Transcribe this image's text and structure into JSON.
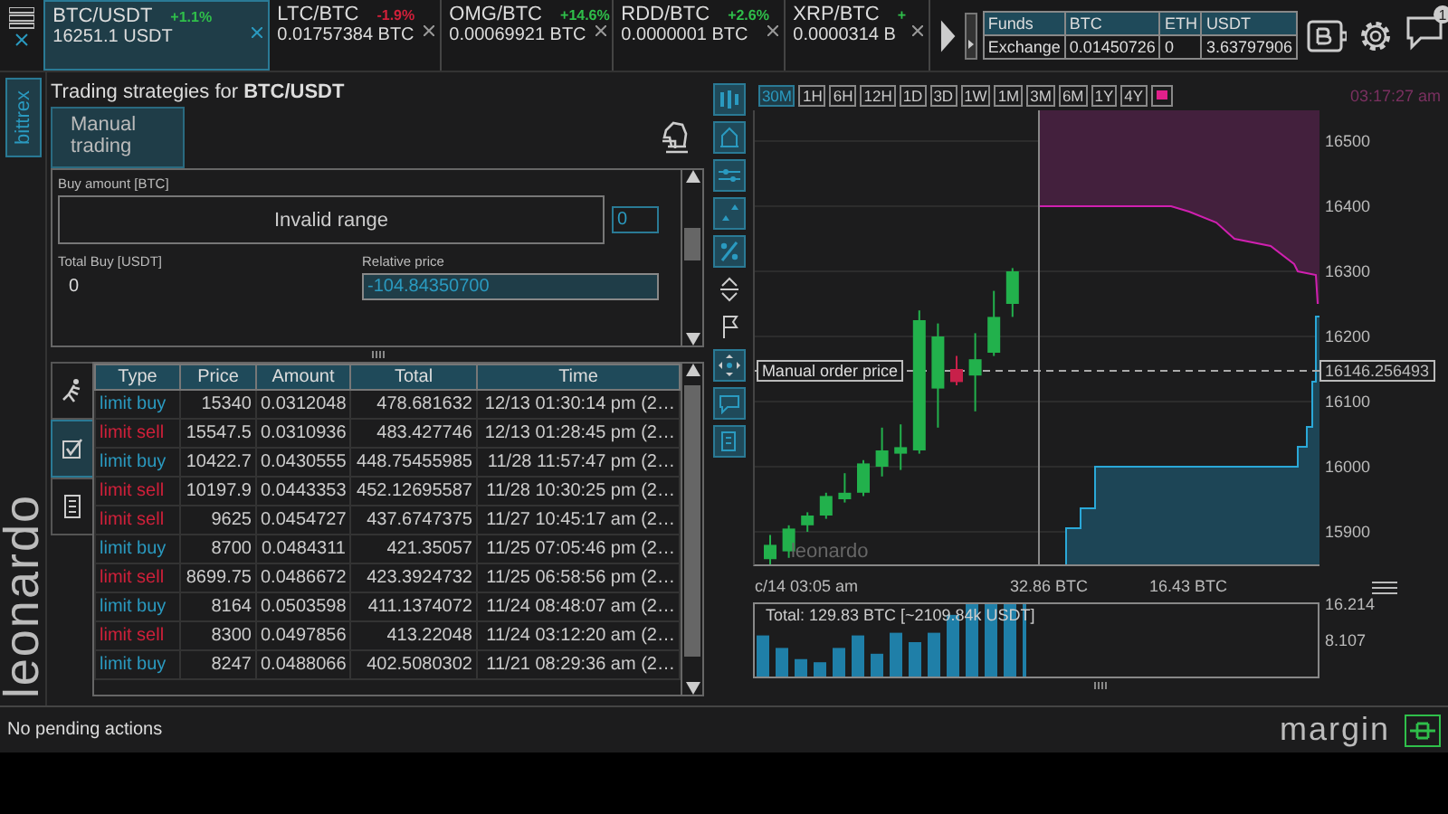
{
  "tickers": [
    {
      "pair": "BTC/USDT",
      "change": "+1.1%",
      "color": "#2fbf4a",
      "price": "16251.1 USDT",
      "selected": true
    },
    {
      "pair": "LTC/BTC",
      "change": "-1.9%",
      "color": "#d0203a",
      "price": "0.01757384 BTC",
      "selected": false
    },
    {
      "pair": "OMG/BTC",
      "change": "+14.6%",
      "color": "#2fbf4a",
      "price": "0.00069921 BTC",
      "selected": false
    },
    {
      "pair": "RDD/BTC",
      "change": "+2.6%",
      "color": "#2fbf4a",
      "price": "0.0000001 BTC",
      "selected": false
    },
    {
      "pair": "XRP/BTC",
      "change": "+",
      "color": "#2fbf4a",
      "price": "0.0000314 B",
      "selected": false
    }
  ],
  "funds": {
    "columns": [
      "Funds",
      "BTC",
      "ETH",
      "USDT"
    ],
    "row": [
      "Exchange",
      "0.01450726",
      "0",
      "3.63797906"
    ]
  },
  "notifications": {
    "badge": "1"
  },
  "exchange_tab": {
    "label": "bittrex",
    "selected": true
  },
  "logo": "leonardo",
  "title": "Trading strategies for **BTC/USDT**",
  "tabs": [
    {
      "label": "Manual trading",
      "selected": true
    }
  ],
  "form": {
    "buy_amount_label": "Buy amount [BTC]",
    "range_message": "Invalid range",
    "amount_value": "0",
    "total_label": "Total Buy [USDT]",
    "total_value": "0",
    "relative_price_label": "Relative price",
    "relative_price_value": "-104.84350700"
  },
  "side_tabs": [
    {
      "kind": "runner",
      "selected": false
    },
    {
      "kind": "checklist",
      "selected": true
    },
    {
      "kind": "scroll",
      "selected": false
    }
  ],
  "orders": {
    "columns": [
      "Type",
      "Price",
      "Amount",
      "Total",
      "Time"
    ],
    "rows": [
      {
        "kind": "buy",
        "type": "limit buy",
        "price": "15340",
        "amount": "0.0312048",
        "total": "478.681632",
        "time": "12/13 01:30:14 pm (2…"
      },
      {
        "kind": "sell",
        "type": "limit sell",
        "price": "15547.5",
        "amount": "0.0310936",
        "total": "483.427746",
        "time": "12/13 01:28:45 pm (2…"
      },
      {
        "kind": "buy",
        "type": "limit buy",
        "price": "10422.7",
        "amount": "0.0430555",
        "total": "448.75455985",
        "time": "11/28 11:57:47 pm (2…"
      },
      {
        "kind": "sell",
        "type": "limit sell",
        "price": "10197.9",
        "amount": "0.0443353",
        "total": "452.12695587",
        "time": "11/28 10:30:25 pm (2…"
      },
      {
        "kind": "sell",
        "type": "limit sell",
        "price": "9625",
        "amount": "0.0454727",
        "total": "437.6747375",
        "time": "11/27 10:45:17 am (2…"
      },
      {
        "kind": "buy",
        "type": "limit buy",
        "price": "8700",
        "amount": "0.0484311",
        "total": "421.35057",
        "time": "11/25 07:05:46 pm (2…"
      },
      {
        "kind": "sell",
        "type": "limit sell",
        "price": "8699.75",
        "amount": "0.0486672",
        "total": "423.3924732",
        "time": "11/25 06:58:56 pm (2…"
      },
      {
        "kind": "buy",
        "type": "limit buy",
        "price": "8164",
        "amount": "0.0503598",
        "total": "411.1374072",
        "time": "11/24 08:48:07 am (2…"
      },
      {
        "kind": "sell",
        "type": "limit sell",
        "price": "8300",
        "amount": "0.0497856",
        "total": "413.22048",
        "time": "11/24 03:12:20 am (2…"
      },
      {
        "kind": "buy",
        "type": "limit buy",
        "price": "8247",
        "amount": "0.0488066",
        "total": "402.5080302",
        "time": "11/21 08:29:36 am (2…"
      }
    ]
  },
  "timeframes": [
    {
      "label": "30M",
      "selected": true
    },
    {
      "label": "1H",
      "selected": false
    },
    {
      "label": "6H",
      "selected": false
    },
    {
      "label": "12H",
      "selected": false
    },
    {
      "label": "1D",
      "selected": false
    },
    {
      "label": "3D",
      "selected": false
    },
    {
      "label": "1W",
      "selected": false
    },
    {
      "label": "1M",
      "selected": false
    },
    {
      "label": "3M",
      "selected": false
    },
    {
      "label": "6M",
      "selected": false
    },
    {
      "label": "1Y",
      "selected": false
    },
    {
      "label": "4Y",
      "selected": false
    }
  ],
  "chart": {
    "timestamp": "03:17:27 am",
    "price_ticks": [
      "16500",
      "16400",
      "16300",
      "16200",
      "16100",
      "16000",
      "15900"
    ],
    "order_label": "Manual order price",
    "order_price": "16146.256493",
    "watermark": "leonardo",
    "time_label": "c/14 03:05 am",
    "depth_labels": [
      "32.86 BTC",
      "16.43 BTC"
    ]
  },
  "volume": {
    "total": "Total: 129.83 BTC [~2109.84k USDT]",
    "axis_labels": [
      "16.214",
      "8.107"
    ]
  },
  "status": {
    "message": "No pending actions",
    "brand": "margin"
  }
}
